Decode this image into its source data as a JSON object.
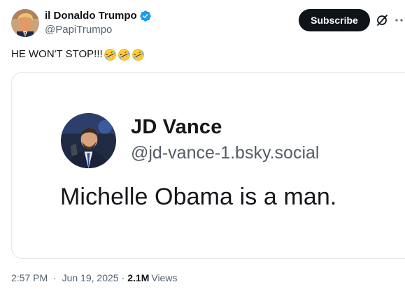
{
  "post": {
    "author": {
      "display_name": "il Donaldo Trumpo",
      "handle": "@PapiTrumpo",
      "verified": true,
      "verified_color": "#1d9bf0"
    },
    "subscribe_label": "Subscribe",
    "text": "HE WON'T STOP!!!",
    "emojis": [
      "rolling-on-floor-laughing",
      "rolling-on-floor-laughing",
      "rolling-on-floor-laughing"
    ],
    "media": {
      "name": "JD Vance",
      "handle": "@jd-vance-1.bsky.social",
      "text": "Michelle Obama is a man."
    },
    "meta": {
      "time": "2:57 PM",
      "separator": "·",
      "date": "Jun 19, 2025",
      "views_count": "2.1M",
      "views_label": "Views"
    }
  },
  "icons": {
    "grok": "grok-icon",
    "more": "more-icon"
  },
  "colors": {
    "text_primary": "#0f1419",
    "text_secondary": "#536471",
    "subscribe_bg": "#0f1419",
    "border": "#e1e6ea"
  }
}
